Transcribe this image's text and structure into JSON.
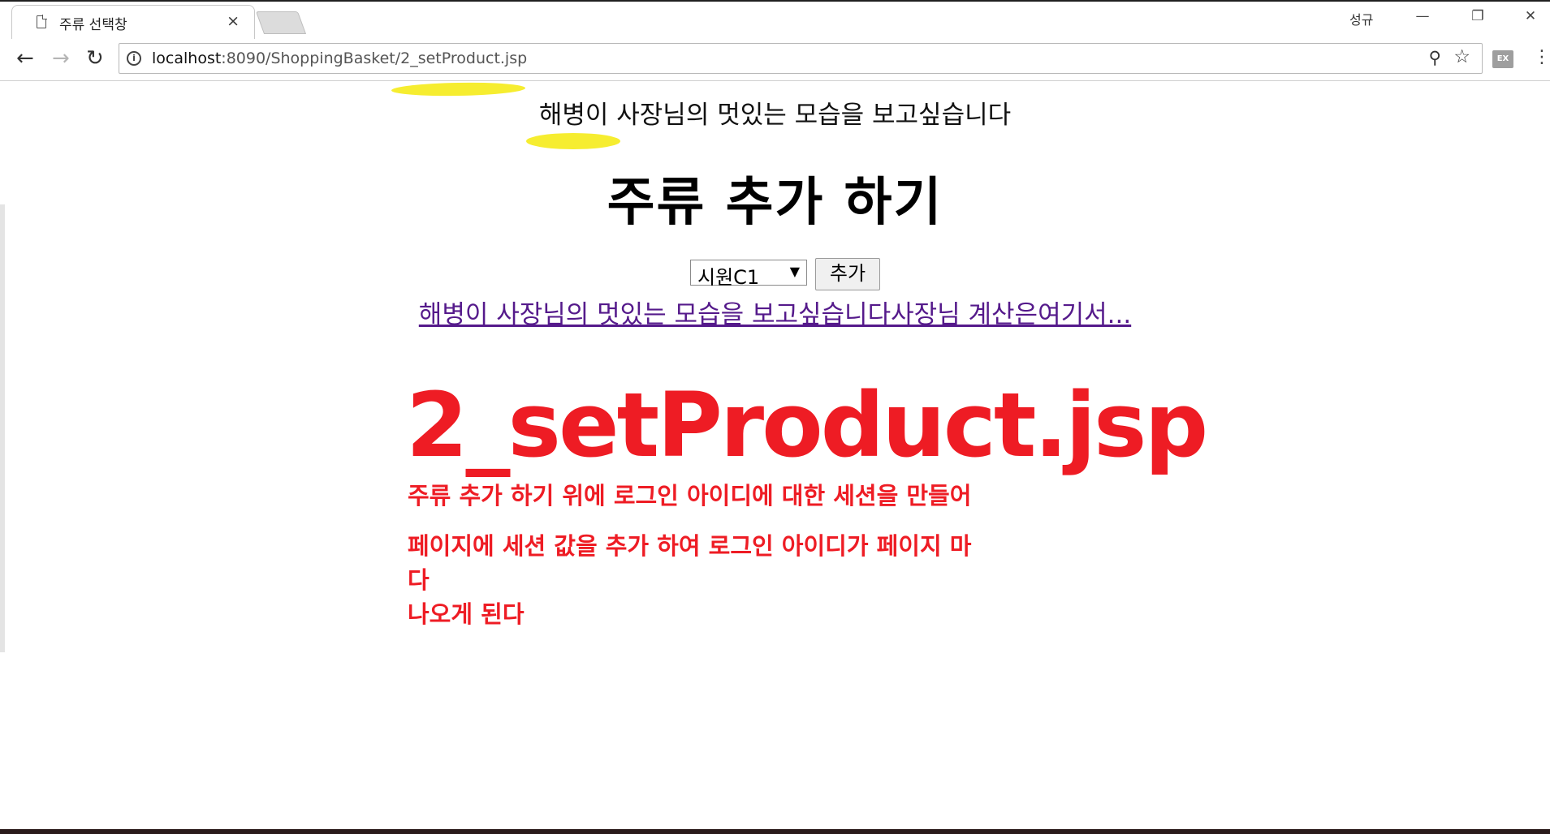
{
  "browser": {
    "tab_title": "주류 선택창",
    "tab_close": "×",
    "profile_name": "성규",
    "url_host": "localhost",
    "url_rest": ":8090/ShoppingBasket/2_setProduct.jsp",
    "window_min": "—",
    "window_restore": "❐",
    "window_close": "✕",
    "ext_label": "EX"
  },
  "page": {
    "greeting": "해병이 사장님의 멋있는 모습을 보고싶습니다",
    "heading": "주류 추가 하기",
    "select_value": "시원C1",
    "add_button": "추가",
    "cart_link": "해병이 사장님의 멋있는 모습을 보고싶습니다사장님 계산은여기서...",
    "annotation_title": "2_setProduct.jsp",
    "annotation_lines": [
      "주류 추가 하기 위에 로그인 아이디에 대한 세션을 만들어",
      "페이지에 세션 값을 추가 하여 로그인 아이디가 페이지 마",
      "다",
      "나오게 된다"
    ]
  },
  "colors": {
    "annotation_red": "#ee1c24",
    "highlight_yellow": "#f5ec25",
    "visited_link": "#551a8b"
  }
}
